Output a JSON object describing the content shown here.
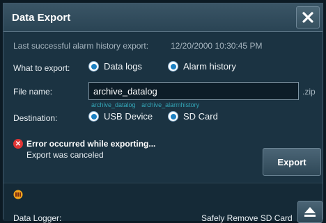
{
  "dialog": {
    "title": "Data Export",
    "close_icon": "close-icon"
  },
  "last_export": {
    "label": "Last successful alarm history export:",
    "value": "12/20/2000 10:30:45 PM"
  },
  "what_to_export": {
    "label": "What to export:",
    "options": [
      {
        "label": "Data logs",
        "selected": true
      },
      {
        "label": "Alarm history",
        "selected": true
      }
    ]
  },
  "file_name": {
    "label": "File name:",
    "value": "archive_datalog",
    "extension": ".zip",
    "hints": [
      "archive_datalog",
      "archive_alarmhistory"
    ]
  },
  "destination": {
    "label": "Destination:",
    "options": [
      {
        "label": "USB Device",
        "selected": true
      },
      {
        "label": "SD Card",
        "selected": true
      }
    ]
  },
  "status": {
    "title": "Error occurred while exporting...",
    "message": "Export was canceled",
    "icon": "error-icon",
    "color": "#e03535"
  },
  "actions": {
    "export_label": "Export"
  },
  "footer": {
    "warning_icon": "warning-icon",
    "logger_label": "Data Logger:",
    "safely_remove_label": "Safely Remove SD Card",
    "eject_icon": "eject-icon"
  },
  "colors": {
    "accent": "#1b80c2",
    "hint": "#33a6b7",
    "background": "#1b3342"
  }
}
